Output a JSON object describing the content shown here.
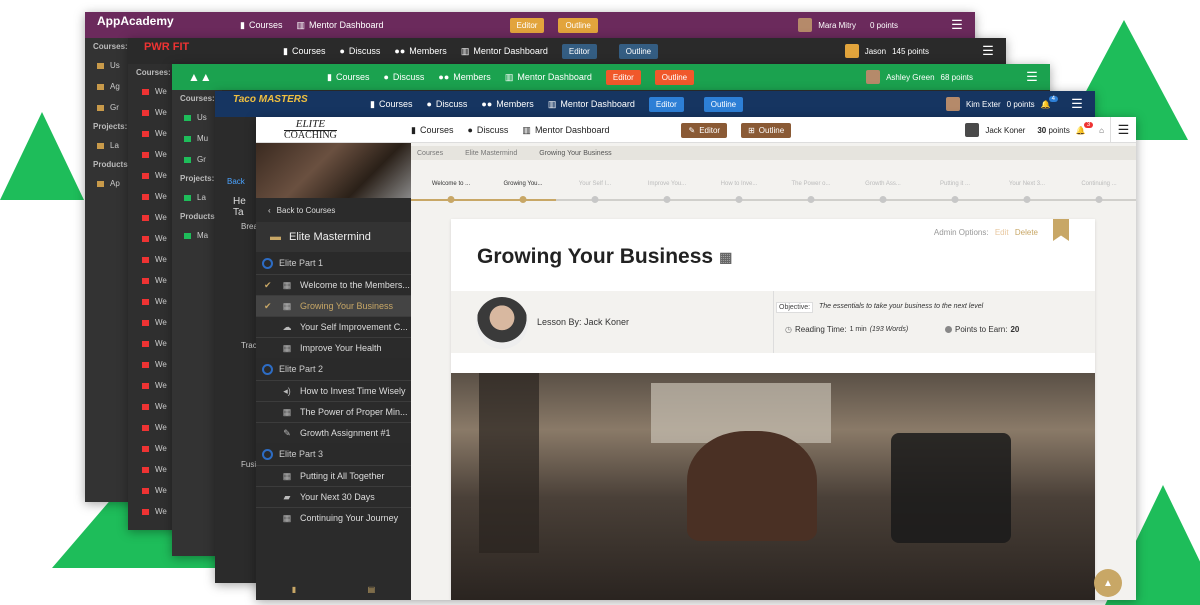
{
  "colors": {
    "green": "#1ebd5a",
    "purple": "#6b2a5c",
    "dark": "#2d2d2d",
    "green_bar": "#1ba24f",
    "navy": "#163561",
    "elite_brown": "#8a5a35",
    "elite_gold": "#c8a766"
  },
  "w1": {
    "logo": "AppAcademy",
    "courses": "Courses",
    "mentor": "Mentor Dashboard",
    "editor": "Editor",
    "outline": "Outline",
    "user": "Mara Mitry",
    "points": "0 points",
    "sidebar_label": "Courses:",
    "items": [
      "Us",
      "Ag",
      "Gr"
    ],
    "projects_label": "Projects:",
    "projects": [
      "La"
    ],
    "products_label": "Products:",
    "products": [
      "Ap"
    ]
  },
  "w2": {
    "logo": "PWR FIT",
    "courses": "Courses",
    "discuss": "Discuss",
    "members": "Members",
    "mentor": "Mentor Dashboard",
    "editor": "Editor",
    "outline": "Outline",
    "user": "Jason",
    "points": "145 points",
    "sidebar_label": "Courses:",
    "items": [
      "We",
      "We",
      "We",
      "We",
      "We",
      "We",
      "We",
      "We",
      "We",
      "We",
      "We",
      "We",
      "We",
      "We",
      "We",
      "We",
      "We",
      "We",
      "We",
      "We",
      "We"
    ]
  },
  "w3": {
    "courses": "Courses",
    "discuss": "Discuss",
    "members": "Members",
    "mentor": "Mentor Dashboard",
    "editor": "Editor",
    "outline": "Outline",
    "user": "Ashley Green",
    "points": "68 points",
    "sidebar_label": "Courses:",
    "items": [
      "Us",
      "Mu",
      "Gr"
    ],
    "projects_label": "Projects:",
    "projects": [
      "La"
    ],
    "products_label": "Products",
    "products": [
      "Ma"
    ]
  },
  "w4": {
    "logo": "Taco MASTERS",
    "courses": "Courses",
    "discuss": "Discuss",
    "members": "Members",
    "mentor": "Mentor Dashboard",
    "editor": "Editor",
    "outline": "Outline",
    "user": "Kim Exter",
    "points": "0 points",
    "badge": "4",
    "back": "Back",
    "section": "He Ta",
    "sub1": "Brea",
    "sub2": "Trac",
    "sub3": "Fusi"
  },
  "w5": {
    "logo_top": "ELITE",
    "logo_bottom": "COACHING",
    "nav": {
      "courses": "Courses",
      "discuss": "Discuss",
      "mentor": "Mentor Dashboard",
      "editor": "Editor",
      "outline": "Outline"
    },
    "user": {
      "name": "Jack Koner",
      "points": "30",
      "points_label": "points",
      "badge": "3"
    },
    "breadcrumb": [
      "Courses",
      "Elite Mastermind",
      "Growing Your Business"
    ],
    "steps": [
      "Welcome to ...",
      "Growing You...",
      "Your Self I...",
      "Improve You...",
      "How to Inve...",
      "The Power o...",
      "Growth Ass...",
      "Putting it ...",
      "Your Next 3...",
      "Continuing ..."
    ],
    "sidebar": {
      "back": "Back to Courses",
      "course_title": "Elite Mastermind",
      "sections": [
        {
          "title": "Elite Part 1",
          "items": [
            {
              "label": "Welcome to the Members...",
              "icon": "film",
              "done": true
            },
            {
              "label": "Growing Your Business",
              "icon": "film",
              "done": true,
              "active": true
            },
            {
              "label": "Your Self Improvement C...",
              "icon": "cloud",
              "done": false
            },
            {
              "label": "Improve Your Health",
              "icon": "film",
              "done": false
            }
          ]
        },
        {
          "title": "Elite Part 2",
          "items": [
            {
              "label": "How to Invest Time Wisely",
              "icon": "audio",
              "done": false
            },
            {
              "label": "The Power of Proper Min...",
              "icon": "film",
              "done": false
            },
            {
              "label": "Growth Assignment #1",
              "icon": "pencil",
              "done": false
            }
          ]
        },
        {
          "title": "Elite Part 3",
          "items": [
            {
              "label": "Putting it All Together",
              "icon": "film",
              "done": false
            },
            {
              "label": "Your Next 30 Days",
              "icon": "chat",
              "done": false
            },
            {
              "label": "Continuing Your Journey",
              "icon": "film",
              "done": false
            }
          ]
        }
      ]
    },
    "lesson": {
      "admin_label": "Admin Options:",
      "edit": "Edit",
      "delete": "Delete",
      "title": "Growing Your Business",
      "by": "Lesson By: Jack Koner",
      "objective_label": "Objective:",
      "objective": "The essentials to take your business to the next level",
      "reading_label": "Reading Time:",
      "reading_value": "1 min",
      "reading_words": "(193 Words)",
      "points_label": "Points to Earn:",
      "points_value": "20"
    }
  }
}
